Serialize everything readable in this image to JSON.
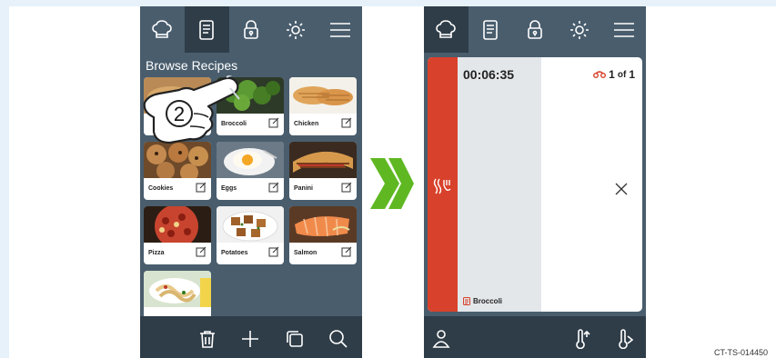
{
  "colors": {
    "screen_bg": "#495d6d",
    "bar_dark": "#2f3d48",
    "accent_red": "#d8412b",
    "arrow_green": "#5fb822",
    "backdrop": "#e6f1fa"
  },
  "left_screen": {
    "topbar": [
      "chef-hat-icon",
      "recipe-book-icon",
      "lock-icon",
      "brightness-icon",
      "menu-icon"
    ],
    "active_tab": "recipe-book-icon",
    "title": "Browse Recipes",
    "cards": [
      {
        "name": "",
        "photo": "bread"
      },
      {
        "name": "Broccoli",
        "photo": "broccoli"
      },
      {
        "name": "Chicken",
        "photo": "chicken"
      },
      {
        "name": "Cookies",
        "photo": "cookies"
      },
      {
        "name": "Eggs",
        "photo": "eggs"
      },
      {
        "name": "Panini",
        "photo": "panini"
      },
      {
        "name": "Pizza",
        "photo": "pizza"
      },
      {
        "name": "Potatoes",
        "photo": "potatoes"
      },
      {
        "name": "Salmon",
        "photo": "salmon"
      },
      {
        "name": "",
        "photo": "pasta"
      }
    ],
    "step_number": "2",
    "bottombar": [
      "trash-icon",
      "plus-icon",
      "copy-icon",
      "search-icon"
    ]
  },
  "right_screen": {
    "topbar": [
      "chef-hat-icon",
      "recipe-book-icon",
      "lock-icon",
      "brightness-icon",
      "menu-icon"
    ],
    "active_tab": "chef-hat-icon",
    "timer": "00:06:35",
    "count_current": "1",
    "count_of": "of",
    "count_total": "1",
    "recipe_name": "Broccoli",
    "mode_icon": "steam-icon",
    "bottombar": [
      "probe-person-icon",
      "probe-temp-up-icon",
      "probe-temp-icon"
    ]
  },
  "footer_code": "CT-TS-014450"
}
